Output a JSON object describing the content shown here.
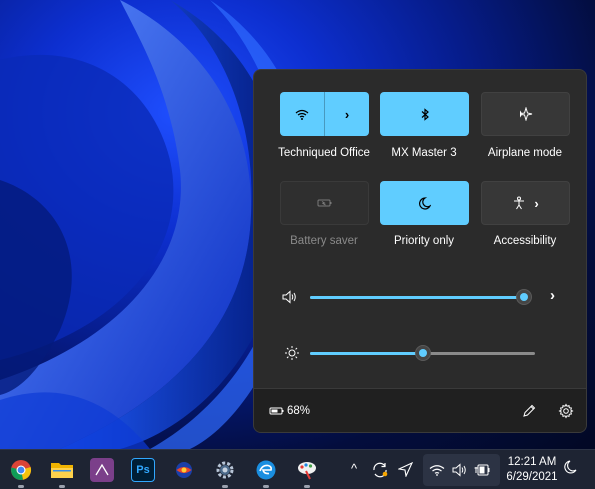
{
  "quick_settings": {
    "tiles": [
      {
        "id": "wifi",
        "label": "Techniqued Office",
        "state": "on",
        "icon": "wifi-icon",
        "has_chevron": true
      },
      {
        "id": "bluetooth",
        "label": "MX Master 3",
        "state": "on",
        "icon": "bluetooth-icon",
        "has_chevron": false
      },
      {
        "id": "airplane",
        "label": "Airplane mode",
        "state": "off",
        "icon": "airplane-icon",
        "has_chevron": false
      },
      {
        "id": "battery_saver",
        "label": "Battery saver",
        "state": "disabled",
        "icon": "battery-saver-icon",
        "has_chevron": false
      },
      {
        "id": "focus_assist",
        "label": "Priority only",
        "state": "on",
        "icon": "moon-icon",
        "has_chevron": false
      },
      {
        "id": "accessibility",
        "label": "Accessibility",
        "state": "off",
        "icon": "accessibility-icon",
        "has_chevron": true
      }
    ],
    "volume": {
      "icon": "speaker-icon",
      "level": 0.98
    },
    "brightness": {
      "icon": "sun-icon",
      "level": 0.5
    },
    "battery": {
      "icon": "battery-icon",
      "text": "68%"
    },
    "footer_icons": [
      "edit-icon",
      "settings-icon"
    ]
  },
  "taskbar": {
    "apps": [
      "chrome-icon",
      "file-explorer-icon",
      "affinity-icon",
      "photoshop-icon",
      "app-icon",
      "settings-app-icon",
      "edge-icon",
      "paint-icon"
    ],
    "tray_icons": [
      "chevron-up-icon",
      "sync-icon",
      "location-icon",
      "wifi-icon",
      "speaker-icon",
      "battery-icon",
      "moon-icon"
    ],
    "time": "12:21 AM",
    "date": "6/29/2021"
  },
  "colors": {
    "accent": "#60cdff",
    "flyout_bg": "#2b2b2b",
    "taskbar_bg": "#1e2433"
  }
}
